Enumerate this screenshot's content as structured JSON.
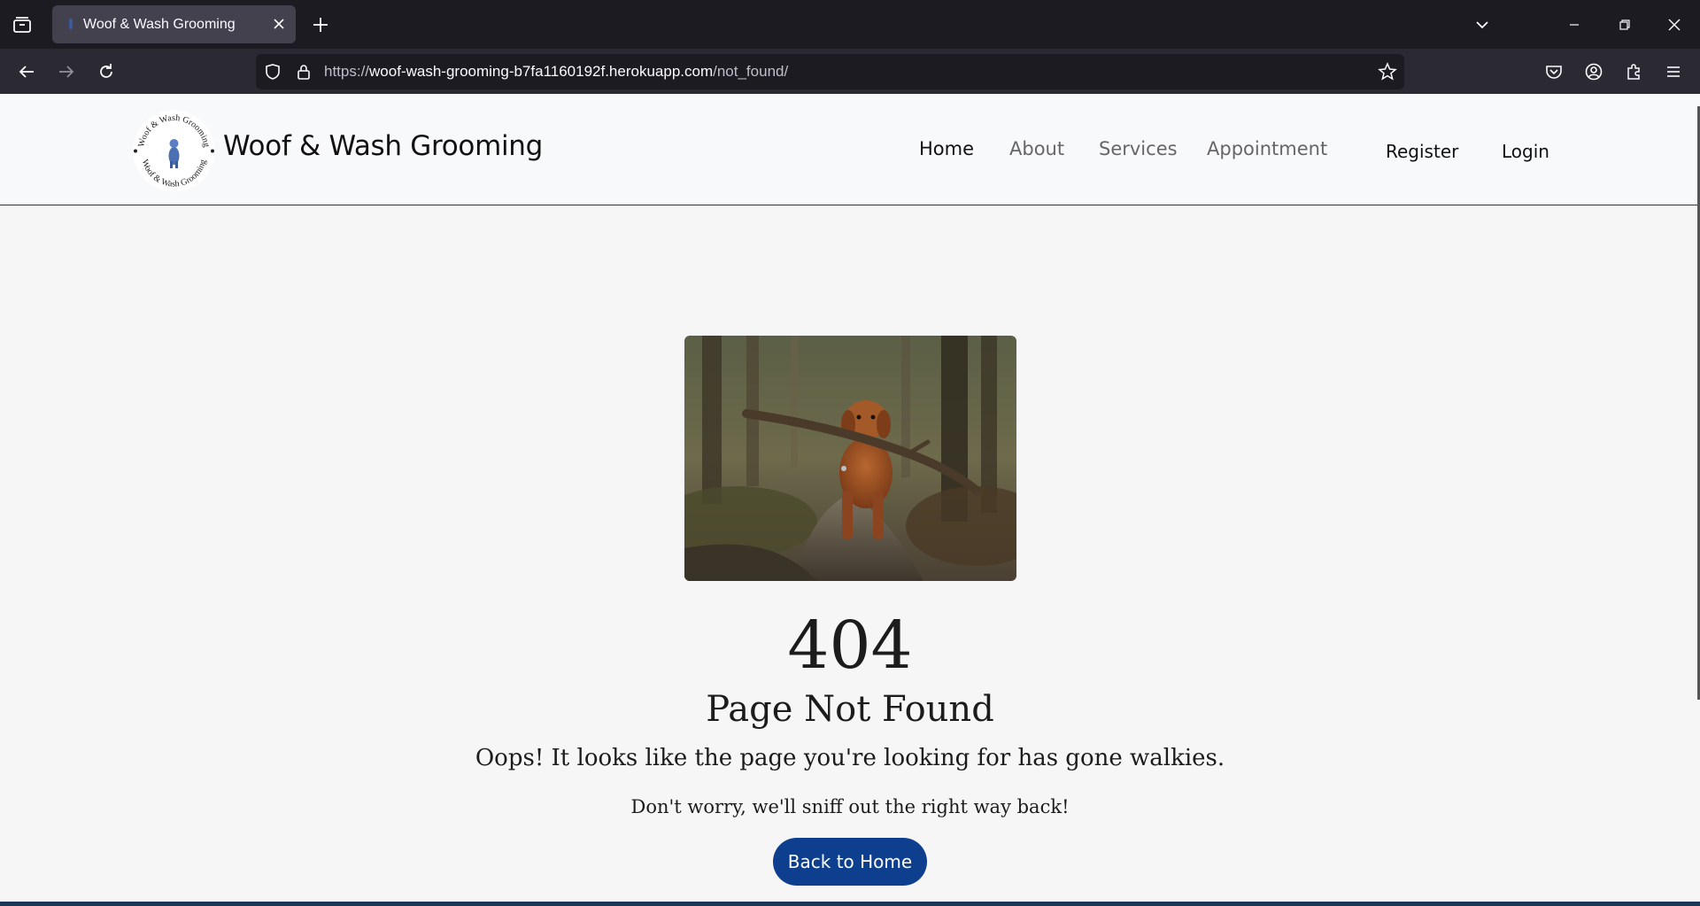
{
  "browser": {
    "tab_title": "Woof & Wash Grooming",
    "url_scheme": "https://",
    "url_host": "woof-wash-grooming-b7fa1160192f.herokuapp.com",
    "url_path": "/not_found/"
  },
  "header": {
    "brand": "Woof & Wash Grooming",
    "logo_ring_text": "Woof & Wash Grooming",
    "nav": {
      "home": "Home",
      "about": "About",
      "services": "Services",
      "appointment": "Appointment",
      "register": "Register",
      "login": "Login"
    }
  },
  "main": {
    "code": "404",
    "heading": "Page Not Found",
    "lead": "Oops! It looks like the page you're looking for has gone walkies.",
    "sub": "Don't worry, we'll sniff out the right way back!",
    "button": "Back to Home"
  },
  "colors": {
    "primary_button": "#0e3f8e",
    "footer_bar": "#1d3557"
  },
  "icons": [
    "tab-list-icon",
    "close-icon",
    "plus-icon",
    "chevron-down-icon",
    "minimize-icon",
    "restore-icon",
    "back-arrow-icon",
    "forward-arrow-icon",
    "reload-icon",
    "shield-icon",
    "lock-icon",
    "star-icon",
    "pocket-icon",
    "account-icon",
    "extensions-icon",
    "menu-icon"
  ]
}
